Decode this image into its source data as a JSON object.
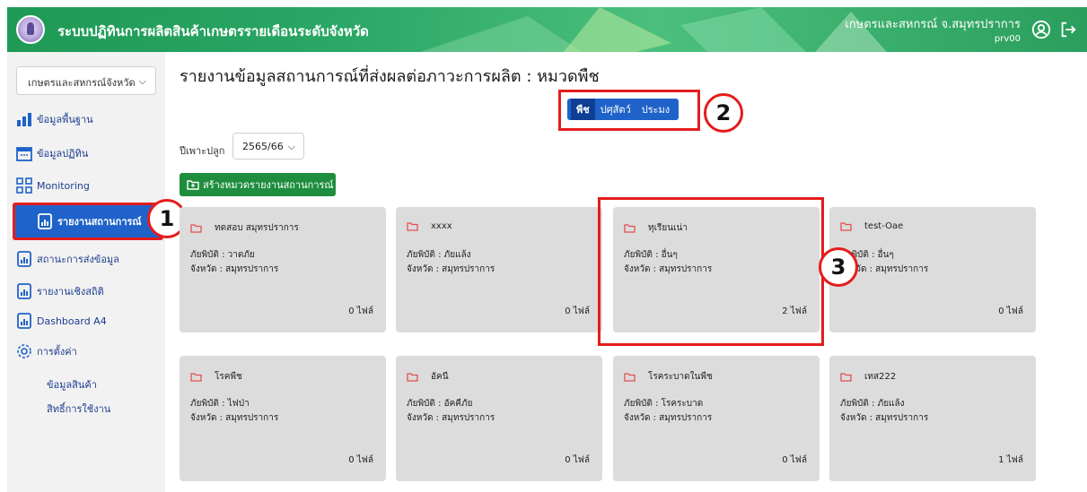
{
  "header": {
    "title": "ระบบปฏิทินการผลิตสินค้าเกษตรรายเดือนระดับจังหวัด",
    "org": "เกษตรและสหกรณ์ จ.สมุทรปราการ",
    "user_id": "prv00",
    "icons": [
      "logo",
      "user-circle-icon",
      "logout-icon"
    ]
  },
  "sidebar": {
    "province_select": "เกษตรและสหกรณ์จังหวัด",
    "items": [
      {
        "label": "ข้อมูลพื้นฐาน",
        "icon": "bar-chart-icon"
      },
      {
        "label": "ข้อมูลปฏิทิน",
        "icon": "calendar-icon"
      },
      {
        "label": "Monitoring",
        "icon": "grid-icon"
      },
      {
        "label": "รายงานสถานการณ์",
        "icon": "report-icon"
      },
      {
        "label": "สถานะการส่งข้อมูล",
        "icon": "report-icon"
      },
      {
        "label": "รายงานเชิงสถิติ",
        "icon": "report-icon"
      },
      {
        "label": "Dashboard A4",
        "icon": "report-icon"
      },
      {
        "label": "การตั้งค่า",
        "icon": "gear-icon"
      }
    ],
    "sub_items": [
      "ข้อมูลสินค้า",
      "สิทธิ์การใช้งาน"
    ]
  },
  "main": {
    "title": "รายงานข้อมูลสถานการณ์ที่ส่งผลต่อภาวะการผลิต : หมวดพืช",
    "tabs": [
      "พืช",
      "ปศุสัตว์",
      "ประมง"
    ],
    "selected_tab": "พืช",
    "season_label": "ปีเพาะปลูก",
    "season_value": "2565/66",
    "create_button": "สร้างหมวดรายงานสถานการณ์",
    "cards": [
      {
        "title": "ทดสอบ สมุทรปราการ",
        "disaster": "ภัยพิบัติ : วาตภัย",
        "province": "จังหวัด : สมุทรปราการ",
        "files": "0 ไฟล์"
      },
      {
        "title": "xxxx",
        "disaster": "ภัยพิบัติ : ภัยแล้ง",
        "province": "จังหวัด : สมุทรปราการ",
        "files": "0 ไฟล์"
      },
      {
        "title": "ทุเรียนเน่า",
        "disaster": "ภัยพิบัติ : อื่นๆ",
        "province": "จังหวัด : สมุทรปราการ",
        "files": "2 ไฟล์"
      },
      {
        "title": "test-Oae",
        "disaster": "ภัยพิบัติ : อื่นๆ",
        "province": "จังหวัด : สมุทรปราการ",
        "files": "0 ไฟล์"
      },
      {
        "title": "โรคพืช",
        "disaster": "ภัยพิบัติ : ไฟป่า",
        "province": "จังหวัด : สมุทรปราการ",
        "files": "0 ไฟล์"
      },
      {
        "title": "อัคนี",
        "disaster": "ภัยพิบัติ : อัคคีภัย",
        "province": "จังหวัด : สมุทรปราการ",
        "files": "0 ไฟล์"
      },
      {
        "title": "โรคระบาดในพืช",
        "disaster": "ภัยพิบัติ : โรคระบาด",
        "province": "จังหวัด : สมุทรปราการ",
        "files": "0 ไฟล์"
      },
      {
        "title": "เทส222",
        "disaster": "ภัยพิบัติ : ภัยแล้ง",
        "province": "จังหวัด : สมุทรปราการ",
        "files": "1 ไฟล์"
      }
    ]
  },
  "callouts": [
    "1",
    "2",
    "3"
  ],
  "colors": {
    "header_green": "#2aa665",
    "primary_blue": "#1f62c9",
    "highlight_red": "#e51c1c",
    "create_green": "#1e8e3e",
    "card_gray": "#dcdcdc"
  }
}
